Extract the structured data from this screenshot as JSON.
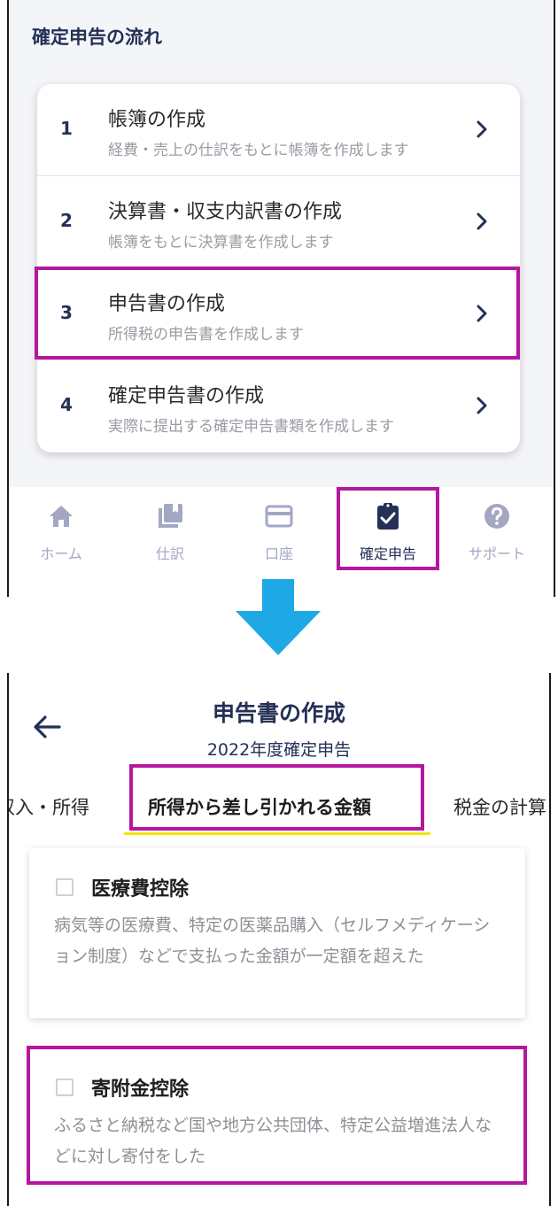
{
  "top_screen": {
    "section_title": "確定申告の流れ",
    "steps": [
      {
        "num": "1",
        "title": "帳簿の作成",
        "subtitle": "経費・売上の仕訳をもとに帳簿を作成します"
      },
      {
        "num": "2",
        "title": "決算書・収支内訳書の作成",
        "subtitle": "帳簿をもとに決算書を作成します"
      },
      {
        "num": "3",
        "title": "申告書の作成",
        "subtitle": "所得税の申告書を作成します"
      },
      {
        "num": "4",
        "title": "確定申告書の作成",
        "subtitle": "実際に提出する確定申告書類を作成します"
      }
    ],
    "nav": [
      {
        "label": "ホーム",
        "icon": "home-icon"
      },
      {
        "label": "仕訳",
        "icon": "journal-icon"
      },
      {
        "label": "口座",
        "icon": "card-icon"
      },
      {
        "label": "確定申告",
        "icon": "clipboard-check-icon",
        "active": true
      },
      {
        "label": "サポート",
        "icon": "help-icon"
      }
    ]
  },
  "bottom_screen": {
    "title": "申告書の作成",
    "subtitle": "2022年度確定申告",
    "tabs": [
      "収入・所得",
      "所得から差し引かれる金額",
      "税金の計算"
    ],
    "active_tab": "所得から差し引かれる金額",
    "deductions": [
      {
        "title": "医療費控除",
        "description": "病気等の医療費、特定の医薬品購入（セルフメディケーション制度）などで支払った金額が一定額を超えた",
        "checked": false
      },
      {
        "title": "寄附金控除",
        "description": "ふるさと納税など国や地方公共団体、特定公益増進法人などに対し寄付をした",
        "checked": false
      }
    ]
  },
  "colors": {
    "navy": "#243056",
    "highlight": "#b5179e",
    "arrow": "#1fa8e6",
    "tab_underline": "#f2e600",
    "nav_inactive": "#a3a7c4"
  }
}
